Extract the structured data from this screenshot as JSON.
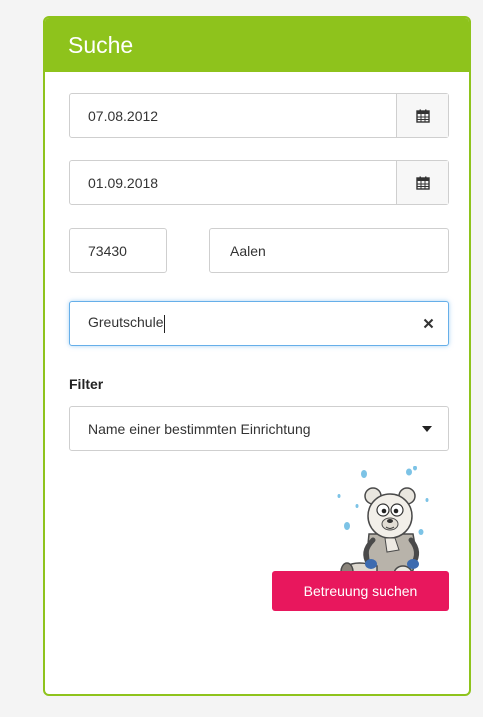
{
  "panel": {
    "title": "Suche"
  },
  "form": {
    "date_from": "07.08.2012",
    "date_to": "01.09.2018",
    "zip": "73430",
    "city": "Aalen",
    "search_text": "Greutschule"
  },
  "filter": {
    "label": "Filter",
    "selected": "Name einer bestimmten Einrichtung"
  },
  "submit_label": "Betreuung suchen",
  "icons": {
    "calendar": "calendar-icon",
    "clear": "close-icon",
    "dropdown": "caret-down-icon",
    "mascot": "bear-mascot"
  },
  "colors": {
    "accent": "#8ec31c",
    "button": "#e8175d",
    "focus": "#66afe9"
  }
}
